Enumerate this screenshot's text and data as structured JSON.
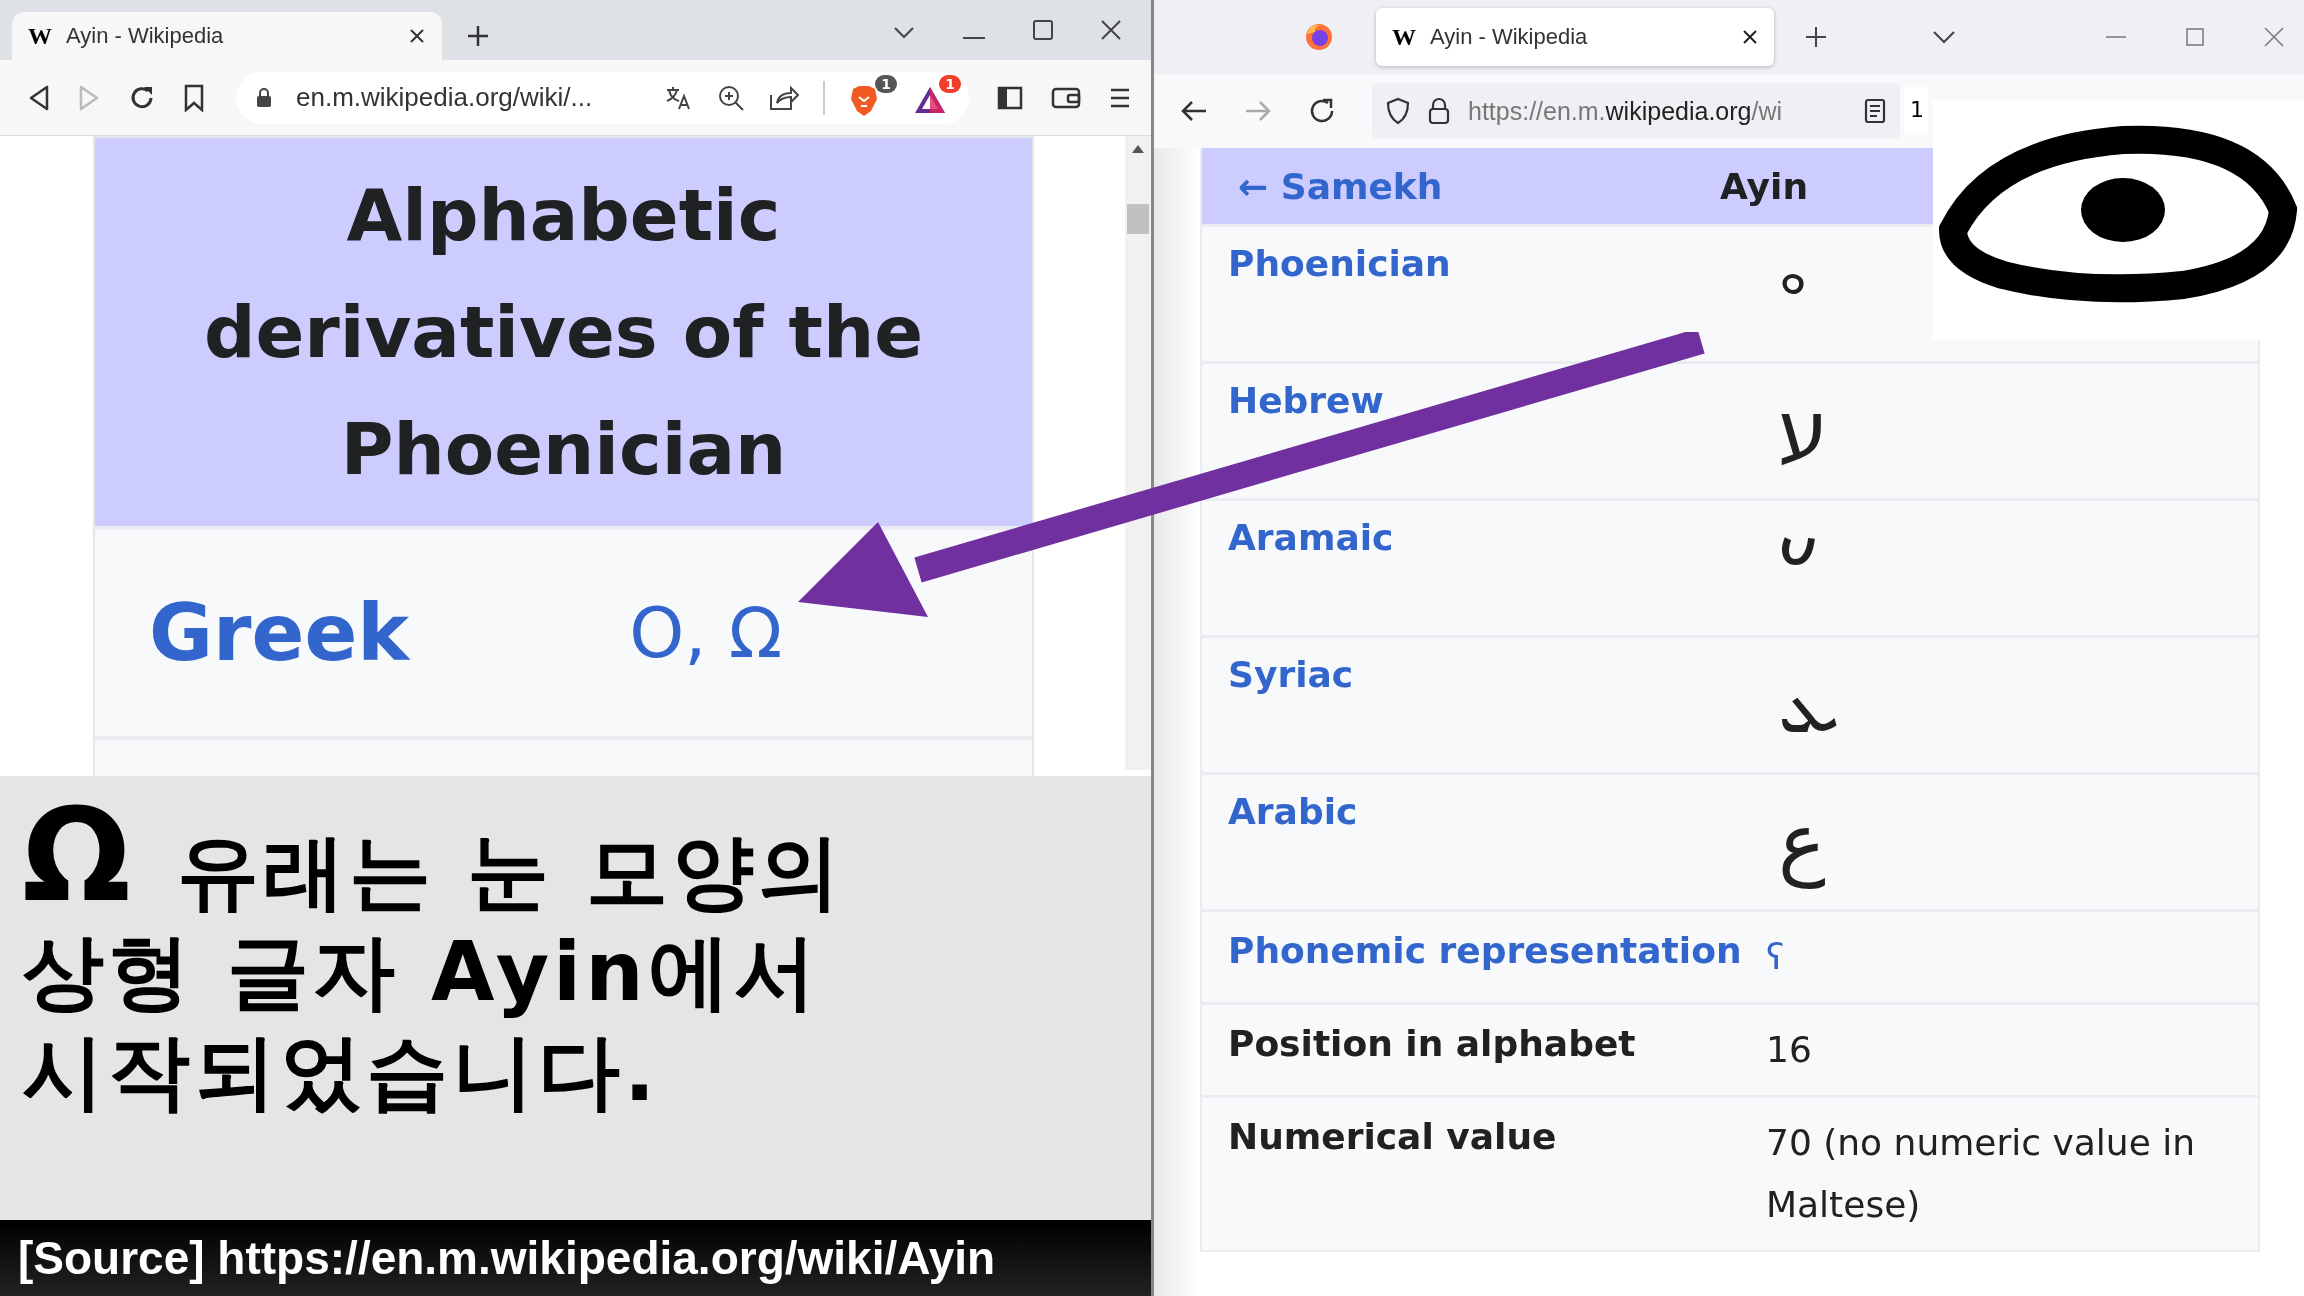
{
  "left_window": {
    "tab": {
      "favicon": "W",
      "title": "Ayin - Wikipedia",
      "selected": true
    },
    "address": "en.m.wikipedia.org/wiki/...",
    "extension_badges": [
      "1",
      "1"
    ],
    "table": {
      "heading": "Alphabetic derivatives of the Phoenician",
      "rows": [
        {
          "label": "Greek",
          "value": "Ο, Ω"
        }
      ]
    }
  },
  "caption": {
    "symbol": "Ω",
    "lines": [
      "유래는 눈 모양의",
      "상형 글자 Ayin에서",
      "시작되었습니다."
    ]
  },
  "source": "[Source] https://en.m.wikipedia.org/wiki/Ayin",
  "right_window": {
    "tab": {
      "favicon": "W",
      "title": "Ayin - Wikipedia",
      "selected": true
    },
    "address_parts": [
      "https://en.m.",
      "wikipedia.org",
      "/wi"
    ],
    "toolbar_field": "1",
    "table": {
      "previous": "← Samekh",
      "title": "Ayin",
      "rows": [
        {
          "kind": "glyph",
          "label": "Phoenician",
          "label_link": true,
          "value": "𐤏",
          "value_link": false
        },
        {
          "kind": "glyph",
          "label": "Hebrew",
          "label_link": true,
          "value": "ע",
          "value_link": false
        },
        {
          "kind": "glyph",
          "label": "Aramaic",
          "label_link": true,
          "value": "𐡏",
          "value_link": false
        },
        {
          "kind": "glyph",
          "label": "Syriac",
          "label_link": true,
          "value": "ܥ",
          "value_link": false
        },
        {
          "kind": "glyph",
          "label": "Arabic",
          "label_link": true,
          "value": "ع",
          "value_link": false
        },
        {
          "kind": "text",
          "label": "Phonemic representation",
          "label_link": true,
          "value": "ʕ",
          "value_link": true
        },
        {
          "kind": "text",
          "label": "Position in alphabet",
          "label_link": false,
          "value": "16",
          "value_link": false
        },
        {
          "kind": "text",
          "label": "Numerical value",
          "label_link": false,
          "value": "70 (no numeric value in Maltese)",
          "value_link": false
        }
      ]
    }
  }
}
